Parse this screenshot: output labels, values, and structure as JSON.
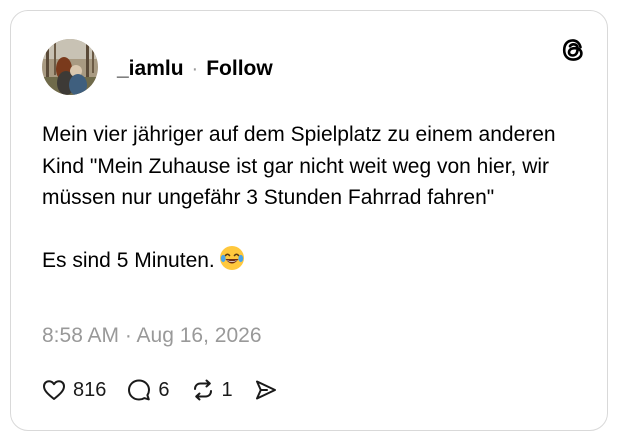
{
  "post": {
    "username": "_iamlu",
    "separator": "·",
    "follow_label": "Follow",
    "text_paragraph_1": "Mein vier jähriger auf dem Spielplatz zu einem anderen Kind \"Mein Zuhause ist gar nicht weit weg von hier, wir müssen nur ungefähr 3 Stunden Fahrrad fahren\"",
    "text_paragraph_2": "Es sind 5 Minuten.",
    "emoji": "face-with-tears-of-joy",
    "timestamp": "8:58 AM · Aug 16, 2026"
  },
  "actions": {
    "like_count": "816",
    "reply_count": "6",
    "repost_count": "1"
  },
  "icons": {
    "logo": "threads-logo-icon",
    "like": "heart-icon",
    "reply": "speech-bubble-icon",
    "repost": "repost-icon",
    "share": "send-icon"
  },
  "colors": {
    "text": "#000000",
    "muted": "#999999",
    "border": "#d9d9d9",
    "emoji_face": "#FFC83D"
  }
}
